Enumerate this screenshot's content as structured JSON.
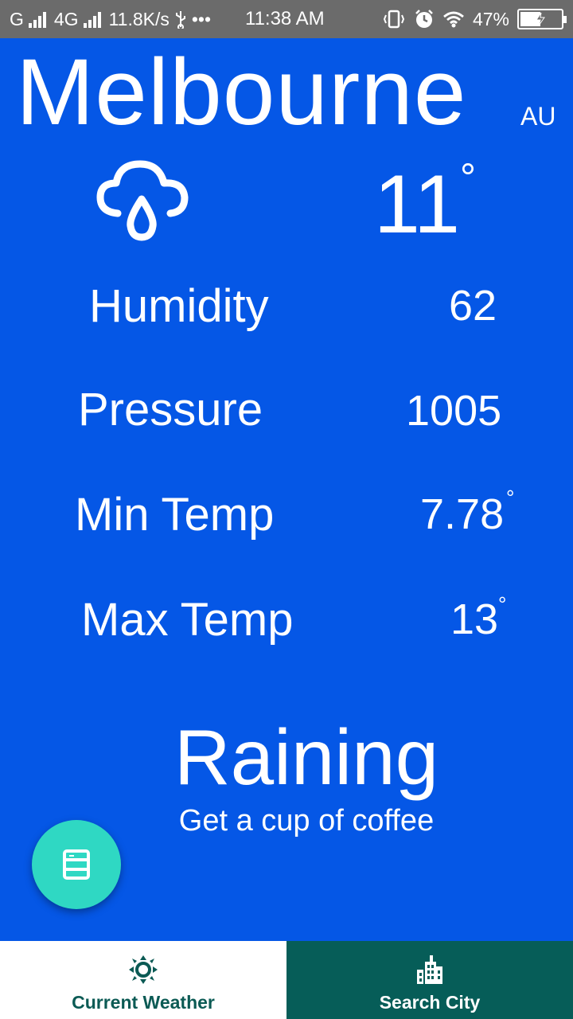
{
  "status_bar": {
    "carrier1": "G",
    "carrier2": "4G",
    "speed": "11.8K/s",
    "more": "•••",
    "time": "11:38 AM",
    "battery": "47%"
  },
  "weather": {
    "city": "Melbourne",
    "country": "AU",
    "icon": "cloud-rain-icon",
    "temperature": "11",
    "degree_symbol": "°",
    "rows": [
      {
        "label": "Humidity",
        "value": "62"
      },
      {
        "label": "Pressure",
        "value": "1005"
      },
      {
        "label": "Min Temp",
        "value": "7.78"
      },
      {
        "label": "Max Temp",
        "value": "13"
      }
    ],
    "condition": "Raining",
    "tip": "Get a cup of coffee"
  },
  "fab": {
    "icon": "notebook-icon"
  },
  "nav": {
    "items": [
      {
        "label": "Current Weather",
        "icon": "sun-icon"
      },
      {
        "label": "Search City",
        "icon": "city-icon"
      }
    ]
  },
  "colors": {
    "background": "#0557e6",
    "fab": "#2fd8c3",
    "nav_active_text": "#0b5a54",
    "nav_inactive_bg": "#065d58"
  }
}
